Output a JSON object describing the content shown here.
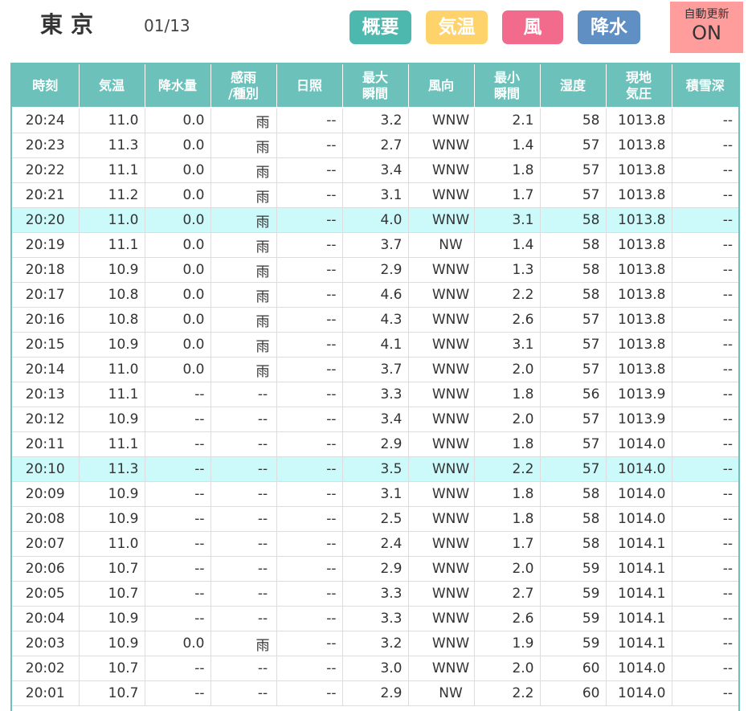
{
  "header": {
    "city": "東京",
    "date": "01/13",
    "tabs": [
      {
        "label": "概要",
        "color": "#4db8ad"
      },
      {
        "label": "気温",
        "color": "#ffd36b"
      },
      {
        "label": "風",
        "color": "#f26b8c"
      },
      {
        "label": "降水",
        "color": "#5f8fc3"
      }
    ],
    "autoupdate": {
      "label": "自動更新",
      "state": "ON",
      "color": "#ff9c9c"
    }
  },
  "table": {
    "header_color": "#6cc2bb",
    "columns": [
      {
        "label": "時刻"
      },
      {
        "label": "気温"
      },
      {
        "label": "降水量"
      },
      {
        "label": "感雨\n/種別"
      },
      {
        "label": "日照"
      },
      {
        "label": "最大\n瞬間"
      },
      {
        "label": "風向"
      },
      {
        "label": "最小\n瞬間"
      },
      {
        "label": "湿度"
      },
      {
        "label": "現地\n気圧"
      },
      {
        "label": "積雪深"
      }
    ],
    "rows": [
      {
        "time": "20:24",
        "temp": "11.0",
        "precip": "0.0",
        "kind": "雨",
        "sun": "--",
        "max": "3.2",
        "dir": "WNW",
        "min": "2.1",
        "hum": "58",
        "press": "1013.8",
        "snow": "--",
        "hl": false
      },
      {
        "time": "20:23",
        "temp": "11.3",
        "precip": "0.0",
        "kind": "雨",
        "sun": "--",
        "max": "2.7",
        "dir": "WNW",
        "min": "1.4",
        "hum": "57",
        "press": "1013.8",
        "snow": "--",
        "hl": false
      },
      {
        "time": "20:22",
        "temp": "11.1",
        "precip": "0.0",
        "kind": "雨",
        "sun": "--",
        "max": "3.4",
        "dir": "WNW",
        "min": "1.8",
        "hum": "57",
        "press": "1013.8",
        "snow": "--",
        "hl": false
      },
      {
        "time": "20:21",
        "temp": "11.2",
        "precip": "0.0",
        "kind": "雨",
        "sun": "--",
        "max": "3.1",
        "dir": "WNW",
        "min": "1.7",
        "hum": "57",
        "press": "1013.8",
        "snow": "--",
        "hl": false
      },
      {
        "time": "20:20",
        "temp": "11.0",
        "precip": "0.0",
        "kind": "雨",
        "sun": "--",
        "max": "4.0",
        "dir": "WNW",
        "min": "3.1",
        "hum": "58",
        "press": "1013.8",
        "snow": "--",
        "hl": true
      },
      {
        "time": "20:19",
        "temp": "11.1",
        "precip": "0.0",
        "kind": "雨",
        "sun": "--",
        "max": "3.7",
        "dir": "NW",
        "min": "1.4",
        "hum": "58",
        "press": "1013.8",
        "snow": "--",
        "hl": false
      },
      {
        "time": "20:18",
        "temp": "10.9",
        "precip": "0.0",
        "kind": "雨",
        "sun": "--",
        "max": "2.9",
        "dir": "WNW",
        "min": "1.3",
        "hum": "58",
        "press": "1013.8",
        "snow": "--",
        "hl": false
      },
      {
        "time": "20:17",
        "temp": "10.8",
        "precip": "0.0",
        "kind": "雨",
        "sun": "--",
        "max": "4.6",
        "dir": "WNW",
        "min": "2.2",
        "hum": "58",
        "press": "1013.8",
        "snow": "--",
        "hl": false
      },
      {
        "time": "20:16",
        "temp": "10.8",
        "precip": "0.0",
        "kind": "雨",
        "sun": "--",
        "max": "4.3",
        "dir": "WNW",
        "min": "2.6",
        "hum": "57",
        "press": "1013.8",
        "snow": "--",
        "hl": false
      },
      {
        "time": "20:15",
        "temp": "10.9",
        "precip": "0.0",
        "kind": "雨",
        "sun": "--",
        "max": "4.1",
        "dir": "WNW",
        "min": "3.1",
        "hum": "57",
        "press": "1013.8",
        "snow": "--",
        "hl": false
      },
      {
        "time": "20:14",
        "temp": "11.0",
        "precip": "0.0",
        "kind": "雨",
        "sun": "--",
        "max": "3.7",
        "dir": "WNW",
        "min": "2.0",
        "hum": "57",
        "press": "1013.8",
        "snow": "--",
        "hl": false
      },
      {
        "time": "20:13",
        "temp": "11.1",
        "precip": "--",
        "kind": "--",
        "sun": "--",
        "max": "3.3",
        "dir": "WNW",
        "min": "1.8",
        "hum": "56",
        "press": "1013.9",
        "snow": "--",
        "hl": false
      },
      {
        "time": "20:12",
        "temp": "10.9",
        "precip": "--",
        "kind": "--",
        "sun": "--",
        "max": "3.4",
        "dir": "WNW",
        "min": "2.0",
        "hum": "57",
        "press": "1013.9",
        "snow": "--",
        "hl": false
      },
      {
        "time": "20:11",
        "temp": "11.1",
        "precip": "--",
        "kind": "--",
        "sun": "--",
        "max": "2.9",
        "dir": "WNW",
        "min": "1.8",
        "hum": "57",
        "press": "1014.0",
        "snow": "--",
        "hl": false
      },
      {
        "time": "20:10",
        "temp": "11.3",
        "precip": "--",
        "kind": "--",
        "sun": "--",
        "max": "3.5",
        "dir": "WNW",
        "min": "2.2",
        "hum": "57",
        "press": "1014.0",
        "snow": "--",
        "hl": true
      },
      {
        "time": "20:09",
        "temp": "10.9",
        "precip": "--",
        "kind": "--",
        "sun": "--",
        "max": "3.1",
        "dir": "WNW",
        "min": "1.8",
        "hum": "58",
        "press": "1014.0",
        "snow": "--",
        "hl": false
      },
      {
        "time": "20:08",
        "temp": "10.9",
        "precip": "--",
        "kind": "--",
        "sun": "--",
        "max": "2.5",
        "dir": "WNW",
        "min": "1.8",
        "hum": "58",
        "press": "1014.0",
        "snow": "--",
        "hl": false
      },
      {
        "time": "20:07",
        "temp": "11.0",
        "precip": "--",
        "kind": "--",
        "sun": "--",
        "max": "2.4",
        "dir": "WNW",
        "min": "1.7",
        "hum": "58",
        "press": "1014.1",
        "snow": "--",
        "hl": false
      },
      {
        "time": "20:06",
        "temp": "10.7",
        "precip": "--",
        "kind": "--",
        "sun": "--",
        "max": "2.9",
        "dir": "WNW",
        "min": "2.0",
        "hum": "59",
        "press": "1014.1",
        "snow": "--",
        "hl": false
      },
      {
        "time": "20:05",
        "temp": "10.7",
        "precip": "--",
        "kind": "--",
        "sun": "--",
        "max": "3.3",
        "dir": "WNW",
        "min": "2.7",
        "hum": "59",
        "press": "1014.1",
        "snow": "--",
        "hl": false
      },
      {
        "time": "20:04",
        "temp": "10.9",
        "precip": "--",
        "kind": "--",
        "sun": "--",
        "max": "3.3",
        "dir": "WNW",
        "min": "2.6",
        "hum": "59",
        "press": "1014.1",
        "snow": "--",
        "hl": false
      },
      {
        "time": "20:03",
        "temp": "10.9",
        "precip": "0.0",
        "kind": "雨",
        "sun": "--",
        "max": "3.2",
        "dir": "WNW",
        "min": "1.9",
        "hum": "59",
        "press": "1014.1",
        "snow": "--",
        "hl": false
      },
      {
        "time": "20:02",
        "temp": "10.7",
        "precip": "--",
        "kind": "--",
        "sun": "--",
        "max": "3.0",
        "dir": "WNW",
        "min": "2.0",
        "hum": "60",
        "press": "1014.0",
        "snow": "--",
        "hl": false
      },
      {
        "time": "20:01",
        "temp": "10.7",
        "precip": "--",
        "kind": "--",
        "sun": "--",
        "max": "2.9",
        "dir": "NW",
        "min": "2.2",
        "hum": "60",
        "press": "1014.0",
        "snow": "--",
        "hl": false
      }
    ]
  }
}
